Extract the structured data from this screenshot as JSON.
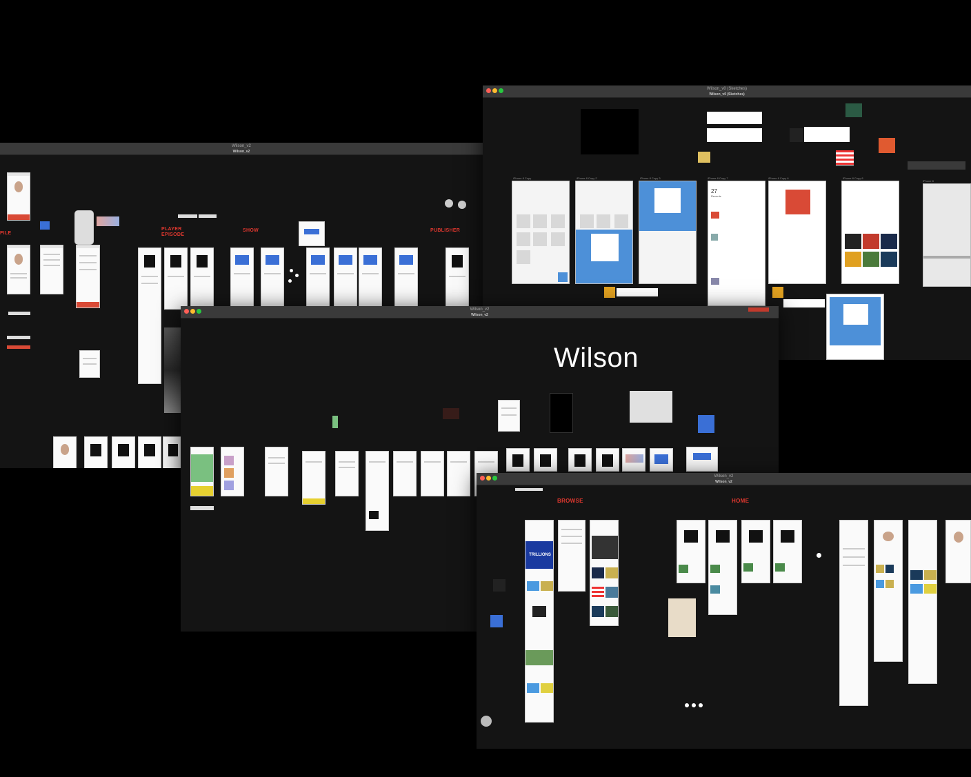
{
  "windows": {
    "left": {
      "title": "Wilson_v2",
      "subtitle": "Wilson_v2"
    },
    "top_right": {
      "title": "Wilson_v0 (Sketches)",
      "subtitle": "Wilson_v0 (Sketches)"
    },
    "center": {
      "title": "Wilson_v2",
      "subtitle": "Wilson_v2"
    },
    "bottom_right": {
      "title": "Wilson_v2",
      "subtitle": "Wilson_v2"
    }
  },
  "left_sections": {
    "profile": "FILE",
    "player": "PLAYER",
    "player2": "EPISODE",
    "show": "SHOW",
    "publisher": "PUBLISHER"
  },
  "center_wordmark": "Wilson",
  "bottom_sections": {
    "browse": "BROWSE",
    "home": "HOME"
  },
  "sketch_labels": [
    "iPhone 8 Copy",
    "iPhone 8 Copy 2",
    "iPhone 8 Copy 3",
    "iPhone 8 Copy 7",
    "iPhone 8 Copy 6",
    "iPhone 8 Copy 8",
    "iPhone 8"
  ],
  "sketch_detail": {
    "date_num": "27",
    "date_label": "Recents"
  },
  "browse_banner": "TRILLIONS",
  "colors": {
    "accent_red": "#e0382f",
    "sketch_blue": "#4d90d8",
    "canvas": "#141414"
  }
}
